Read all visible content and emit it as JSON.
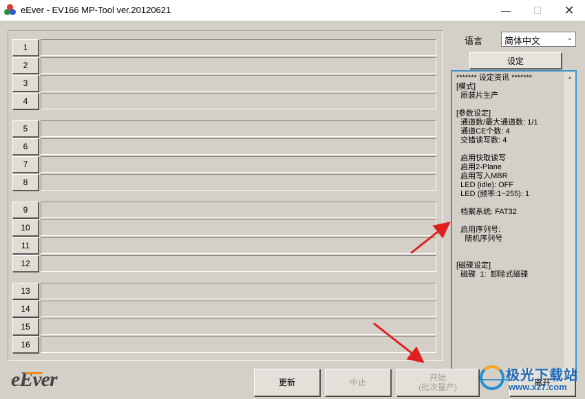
{
  "window": {
    "title": "eEver - EV166 MP-Tool ver.20120621",
    "minimize_icon": "minimize-icon",
    "maximize_icon": "maximize-icon",
    "close_icon": "close-icon"
  },
  "slots": {
    "group1": [
      "1",
      "2",
      "3",
      "4"
    ],
    "group2": [
      "5",
      "6",
      "7",
      "8"
    ],
    "group3": [
      "9",
      "10",
      "11",
      "12"
    ],
    "group4": [
      "13",
      "14",
      "15",
      "16"
    ]
  },
  "language": {
    "label": "语言",
    "selected": "简体中文"
  },
  "settings_button": "设定",
  "info": {
    "header": "******* 设定资讯 *******",
    "mode_title": "[模式]",
    "mode_value": "  原装片生产",
    "param_title": "[参数设定]",
    "channels": "  通道数/最大通道数: 1/1",
    "ce_count": "  通道CE个数: 4",
    "interleave": "  交错读写数: 4",
    "fast_rw": "  启用快取读写",
    "two_plane": "  启用2-Plane",
    "mbr": "  启用写入MBR",
    "led_idle": "  LED (idle): OFF",
    "led_freq": "  LED (频率:1~255): 1",
    "fs": "  档案系统: FAT32",
    "serial": "  启用序列号:",
    "serial_value": "    随机序列号",
    "disk_title": "[磁碟设定]",
    "disk_value": "  磁碟  1:  卸除式磁碟"
  },
  "logo": "eEver",
  "buttons": {
    "update": "更新",
    "stop": "中止",
    "start_line1": "开始",
    "start_line2": "(批次量产)",
    "exit": "离开"
  },
  "watermark": {
    "title": "极光下载站",
    "url": "www.xz7.com"
  },
  "colors": {
    "panel_bg": "#d4d0c8",
    "info_border": "#3f93c8",
    "annotation_arrow": "#e02020"
  }
}
